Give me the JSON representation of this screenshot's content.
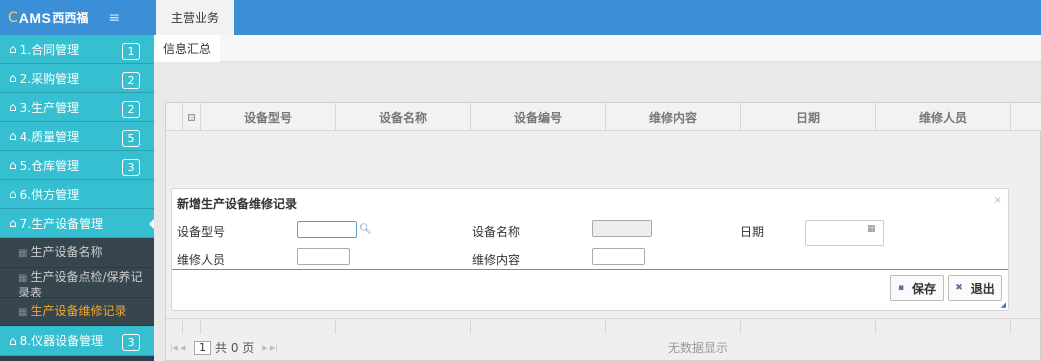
{
  "logo": {
    "mark": "AMS",
    "cn": "西西福"
  },
  "menu_icon": "menu-icon",
  "nav": [
    {
      "label": "1.合同管理",
      "badge": "1"
    },
    {
      "label": "2.采购管理",
      "badge": "2"
    },
    {
      "label": "3.生产管理",
      "badge": "2"
    },
    {
      "label": "4.质量管理",
      "badge": "5"
    },
    {
      "label": "5.仓库管理",
      "badge": "3"
    },
    {
      "label": "6.供方管理",
      "badge": ""
    },
    {
      "label": "7.生产设备管理",
      "badge": ""
    }
  ],
  "subnav": [
    {
      "label": "生产设备名称"
    },
    {
      "label": "生产设备点检/保养记录表"
    },
    {
      "label": "生产设备维修记录"
    }
  ],
  "nav_bottom": {
    "label": "8.仪器设备管理",
    "badge": "3"
  },
  "tabs": {
    "main": "主营业务",
    "sub": "信息汇总"
  },
  "grid": {
    "columns": [
      "设备型号",
      "设备名称",
      "设备编号",
      "维修内容",
      "日期",
      "维修人员"
    ],
    "pager": {
      "page_input": "1",
      "total_text": "共 0 页",
      "empty_text": "无数据显示"
    }
  },
  "modal": {
    "title": "新增生产设备维修记录",
    "close": "×",
    "fields": {
      "model_label": "设备型号",
      "name_label": "设备名称",
      "date_label": "日期",
      "person_label": "维修人员",
      "content_label": "维修内容"
    },
    "buttons": {
      "save": "保存",
      "exit": "退出"
    }
  },
  "colors": {
    "nav_bg": "#35bfd0",
    "top_bar": "#3a8fd6",
    "sidebar_dark": "#2d3e50",
    "active_sub": "#f5a623"
  }
}
